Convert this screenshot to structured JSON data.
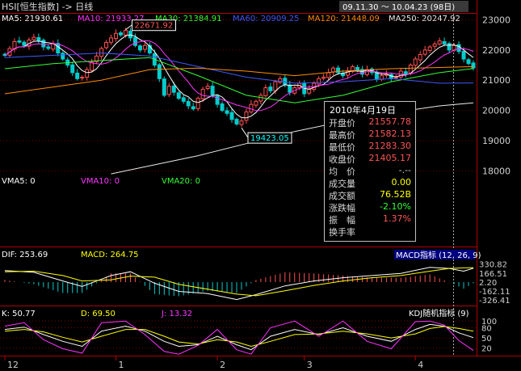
{
  "header": {
    "symbol": "HSI[恒生指数] -> 日线",
    "date_range": "09.11.30 ～ 10.04.23 (98日)"
  },
  "colors": {
    "ma5": "#ffffff",
    "ma10": "#ff33ff",
    "ma30": "#33ff33",
    "ma60": "#3b5bff",
    "ma120": "#ff8c00",
    "ma250": "#e8e8e8",
    "candle": "#00cccc",
    "grid": "#7a0000",
    "axis": "#b00000",
    "diff": "#ffffff",
    "dea": "#ffff00",
    "k": "#ffffff",
    "d": "#ffff00",
    "j": "#ff33ff",
    "label_red": "#ff5555",
    "label_green": "#33ff33",
    "label_cyan": "#00ffff"
  },
  "chart_data": [
    {
      "type": "candlestick",
      "title": "HSI[恒生指数] -> 日线",
      "ylim": [
        17500,
        23200
      ],
      "y_ticks": [
        18000,
        19000,
        20000,
        21000,
        22000,
        23000
      ],
      "x_ticks": [
        {
          "label": "12",
          "index": 0
        },
        {
          "label": "1",
          "index": 23
        },
        {
          "label": "2",
          "index": 44
        },
        {
          "label": "3",
          "index": 62
        },
        {
          "label": "4",
          "index": 85
        }
      ],
      "annotations": [
        {
          "label": "22671.92",
          "kind": "high",
          "value": 22671.92,
          "index": 25
        },
        {
          "label": "19423.05",
          "kind": "low",
          "value": 19423.05,
          "index": 49
        }
      ],
      "legend": [
        {
          "name": "MA5",
          "value": "21930.61"
        },
        {
          "name": "MA10",
          "value": "21933.27"
        },
        {
          "name": "MA30",
          "value": "21384.91"
        },
        {
          "name": "MA60",
          "value": "20909.25"
        },
        {
          "name": "MA120",
          "value": "21448.09"
        },
        {
          "name": "MA250",
          "value": "20247.92"
        }
      ],
      "close": [
        21820,
        22050,
        22280,
        22260,
        22150,
        22330,
        22420,
        22300,
        22100,
        22050,
        22200,
        21900,
        21700,
        21500,
        21250,
        21050,
        21100,
        21350,
        21600,
        21800,
        22050,
        22250,
        22400,
        22550,
        22500,
        22650,
        22400,
        22150,
        22000,
        22150,
        21900,
        21500,
        21050,
        20500,
        20800,
        20600,
        20400,
        20300,
        20150,
        20050,
        20400,
        20700,
        20800,
        20500,
        20200,
        20000,
        19900,
        19700,
        19550,
        19650,
        19950,
        20200,
        20300,
        20500,
        20750,
        20650,
        20950,
        21050,
        20850,
        20600,
        20750,
        20900,
        20550,
        20700,
        20900,
        21050,
        21100,
        21250,
        21400,
        21250,
        21150,
        21300,
        21450,
        21350,
        21200,
        21350,
        21250,
        21050,
        21150,
        21200,
        21050,
        21100,
        21300,
        21200,
        21500,
        21700,
        21850,
        22000,
        22100,
        22200,
        22300,
        22200,
        22000,
        22150,
        21950,
        21700,
        21550,
        21405
      ],
      "ma_lines": {
        "MA30": [
          [
            0,
            21380
          ],
          [
            10,
            21550
          ],
          [
            20,
            21650
          ],
          [
            30,
            21750
          ],
          [
            40,
            21150
          ],
          [
            50,
            20500
          ],
          [
            60,
            20250
          ],
          [
            70,
            20500
          ],
          [
            80,
            20950
          ],
          [
            90,
            21250
          ],
          [
            97,
            21385
          ]
        ],
        "MA60": [
          [
            0,
            21750
          ],
          [
            20,
            21900
          ],
          [
            30,
            21800
          ],
          [
            40,
            21450
          ],
          [
            50,
            21100
          ],
          [
            60,
            20900
          ],
          [
            70,
            20950
          ],
          [
            80,
            21050
          ],
          [
            90,
            20900
          ],
          [
            97,
            20910
          ]
        ],
        "MA120": [
          [
            0,
            20550
          ],
          [
            20,
            21000
          ],
          [
            30,
            21350
          ],
          [
            40,
            21400
          ],
          [
            50,
            21300
          ],
          [
            60,
            21150
          ],
          [
            70,
            21300
          ],
          [
            80,
            21380
          ],
          [
            90,
            21420
          ],
          [
            97,
            21450
          ]
        ],
        "MA250": [
          [
            22,
            17900
          ],
          [
            40,
            18500
          ],
          [
            60,
            19300
          ],
          [
            75,
            19800
          ],
          [
            90,
            20150
          ],
          [
            97,
            20250
          ]
        ]
      }
    },
    {
      "type": "bar",
      "title": "",
      "legend": [
        {
          "name": "VMA5",
          "value": "0"
        },
        {
          "name": "VMA10",
          "value": "0"
        },
        {
          "name": "VMA20",
          "value": "0"
        }
      ]
    },
    {
      "type": "line",
      "title": "MACD指标 (12, 26, 9)",
      "ylim": [
        -400,
        400
      ],
      "y_ticks": [
        "330.82",
        "166.51",
        "2.20",
        "-162.11",
        "-326.41"
      ],
      "legend": [
        {
          "name": "DIF",
          "value": "253.69"
        },
        {
          "name": "MACD",
          "value": "264.75"
        }
      ],
      "dif": [
        [
          0,
          210
        ],
        [
          6,
          180
        ],
        [
          12,
          20
        ],
        [
          16,
          -80
        ],
        [
          22,
          120
        ],
        [
          26,
          190
        ],
        [
          31,
          -20
        ],
        [
          36,
          -170
        ],
        [
          42,
          -210
        ],
        [
          48,
          -320
        ],
        [
          52,
          -230
        ],
        [
          58,
          -70
        ],
        [
          64,
          20
        ],
        [
          70,
          80
        ],
        [
          76,
          120
        ],
        [
          82,
          160
        ],
        [
          88,
          270
        ],
        [
          92,
          250
        ],
        [
          95,
          200
        ],
        [
          97,
          254
        ]
      ],
      "dea": [
        [
          0,
          190
        ],
        [
          6,
          200
        ],
        [
          12,
          120
        ],
        [
          16,
          20
        ],
        [
          22,
          40
        ],
        [
          26,
          110
        ],
        [
          31,
          90
        ],
        [
          36,
          -40
        ],
        [
          42,
          -130
        ],
        [
          48,
          -220
        ],
        [
          52,
          -250
        ],
        [
          58,
          -160
        ],
        [
          64,
          -60
        ],
        [
          70,
          20
        ],
        [
          76,
          80
        ],
        [
          82,
          120
        ],
        [
          88,
          200
        ],
        [
          92,
          250
        ],
        [
          95,
          260
        ],
        [
          97,
          265
        ]
      ]
    },
    {
      "type": "line",
      "title": "KDJ随机指标 (9)",
      "ylim": [
        0,
        110
      ],
      "y_ticks": [
        "100",
        "80",
        "50",
        "20"
      ],
      "legend": [
        {
          "name": "K",
          "value": "50.77"
        },
        {
          "name": "D",
          "value": "69.50"
        },
        {
          "name": "J",
          "value": "13.32"
        }
      ],
      "k": [
        [
          0,
          75
        ],
        [
          4,
          82
        ],
        [
          8,
          60
        ],
        [
          12,
          40
        ],
        [
          16,
          25
        ],
        [
          20,
          70
        ],
        [
          25,
          85
        ],
        [
          29,
          70
        ],
        [
          33,
          40
        ],
        [
          36,
          25
        ],
        [
          40,
          30
        ],
        [
          44,
          55
        ],
        [
          48,
          30
        ],
        [
          51,
          15
        ],
        [
          55,
          55
        ],
        [
          60,
          75
        ],
        [
          65,
          60
        ],
        [
          70,
          80
        ],
        [
          75,
          55
        ],
        [
          80,
          40
        ],
        [
          85,
          75
        ],
        [
          88,
          90
        ],
        [
          91,
          85
        ],
        [
          94,
          65
        ],
        [
          97,
          51
        ]
      ],
      "d": [
        [
          0,
          70
        ],
        [
          4,
          75
        ],
        [
          8,
          68
        ],
        [
          12,
          52
        ],
        [
          16,
          38
        ],
        [
          20,
          55
        ],
        [
          25,
          75
        ],
        [
          29,
          75
        ],
        [
          33,
          55
        ],
        [
          36,
          38
        ],
        [
          40,
          32
        ],
        [
          44,
          45
        ],
        [
          48,
          38
        ],
        [
          51,
          25
        ],
        [
          55,
          40
        ],
        [
          60,
          60
        ],
        [
          65,
          62
        ],
        [
          70,
          70
        ],
        [
          75,
          62
        ],
        [
          80,
          50
        ],
        [
          85,
          62
        ],
        [
          88,
          78
        ],
        [
          91,
          84
        ],
        [
          94,
          78
        ],
        [
          97,
          70
        ]
      ],
      "j": [
        [
          0,
          85
        ],
        [
          4,
          95
        ],
        [
          8,
          45
        ],
        [
          12,
          18
        ],
        [
          16,
          5
        ],
        [
          20,
          95
        ],
        [
          25,
          100
        ],
        [
          29,
          60
        ],
        [
          33,
          10
        ],
        [
          36,
          2
        ],
        [
          40,
          28
        ],
        [
          44,
          75
        ],
        [
          48,
          15
        ],
        [
          51,
          2
        ],
        [
          55,
          80
        ],
        [
          60,
          100
        ],
        [
          65,
          55
        ],
        [
          70,
          100
        ],
        [
          75,
          40
        ],
        [
          80,
          18
        ],
        [
          85,
          98
        ],
        [
          88,
          100
        ],
        [
          91,
          88
        ],
        [
          94,
          42
        ],
        [
          97,
          13
        ]
      ]
    }
  ],
  "tooltip": {
    "date": "2010年4月19日",
    "rows": [
      {
        "label": "开盘价",
        "value": "21557.78",
        "color": "#ff5555"
      },
      {
        "label": "最高价",
        "value": "21582.13",
        "color": "#ff5555"
      },
      {
        "label": "最低价",
        "value": "21283.30",
        "color": "#ff5555"
      },
      {
        "label": "收盘价",
        "value": "21405.17",
        "color": "#ff5555"
      },
      {
        "label": "均　价",
        "value": "-.--",
        "color": "#d8d8d8"
      },
      {
        "label": "成交量",
        "value": "0.00",
        "color": "#ffff00"
      },
      {
        "label": "成交额",
        "value": "76.52B",
        "color": "#ffff00"
      },
      {
        "label": "涨跌幅",
        "value": "-2.10%",
        "color": "#33ff33"
      },
      {
        "label": "振　幅",
        "value": "1.37%",
        "color": "#ff5555"
      },
      {
        "label": "换手率",
        "value": "",
        "color": "#d8d8d8"
      }
    ]
  }
}
